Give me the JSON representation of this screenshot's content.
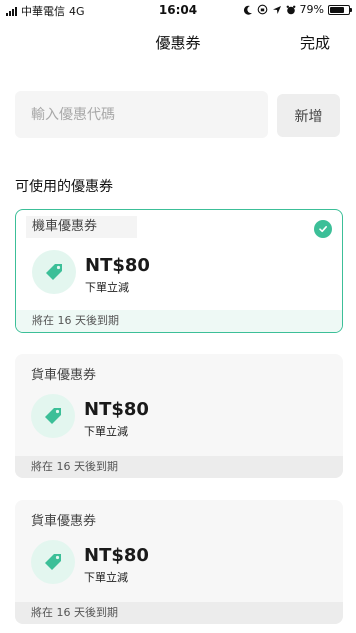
{
  "status_bar": {
    "carrier": "中華電信",
    "network": "4G",
    "time": "16:04",
    "battery": "79%",
    "battery_level": 0.79
  },
  "nav": {
    "title": "優惠券",
    "done_label": "完成"
  },
  "promo": {
    "placeholder": "輸入優惠代碼",
    "add_label": "新增"
  },
  "section": {
    "title": "可使用的優惠券"
  },
  "coupons": [
    {
      "name": "機車優惠券",
      "amount": "NT$80",
      "desc": "下單立減",
      "expiry": "將在 16 天後到期",
      "selected": true
    },
    {
      "name": "貨車優惠券",
      "amount": "NT$80",
      "desc": "下單立減",
      "expiry": "將在 16 天後到期",
      "selected": false
    },
    {
      "name": "貨車優惠券",
      "amount": "NT$80",
      "desc": "下單立減",
      "expiry": "將在 16 天後到期",
      "selected": false
    }
  ],
  "colors": {
    "accent": "#3cbf98",
    "icon_bg": "#e3f6ef"
  },
  "icons": {
    "coupon": "tag-icon",
    "selected": "check-icon"
  }
}
